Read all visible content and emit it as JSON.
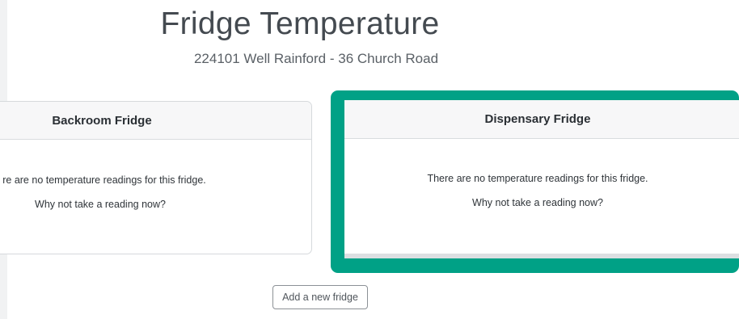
{
  "header": {
    "title": "Fridge Temperature",
    "subtitle": "224101 Well Rainford - 36 Church Road"
  },
  "fridges": [
    {
      "name": "Backroom Fridge",
      "empty_message": "re are no temperature readings for this fridge.",
      "prompt": "Why not take a reading now?"
    },
    {
      "name": "Dispensary Fridge",
      "empty_message": "There are no temperature readings for this fridge.",
      "prompt": "Why not take a reading now?",
      "highlighted": true
    }
  ],
  "actions": {
    "add_fridge_label": "Add a new fridge"
  },
  "colors": {
    "highlight": "#00a186",
    "card_header_bg": "#f7f7f8",
    "border": "#d6d9dc"
  }
}
